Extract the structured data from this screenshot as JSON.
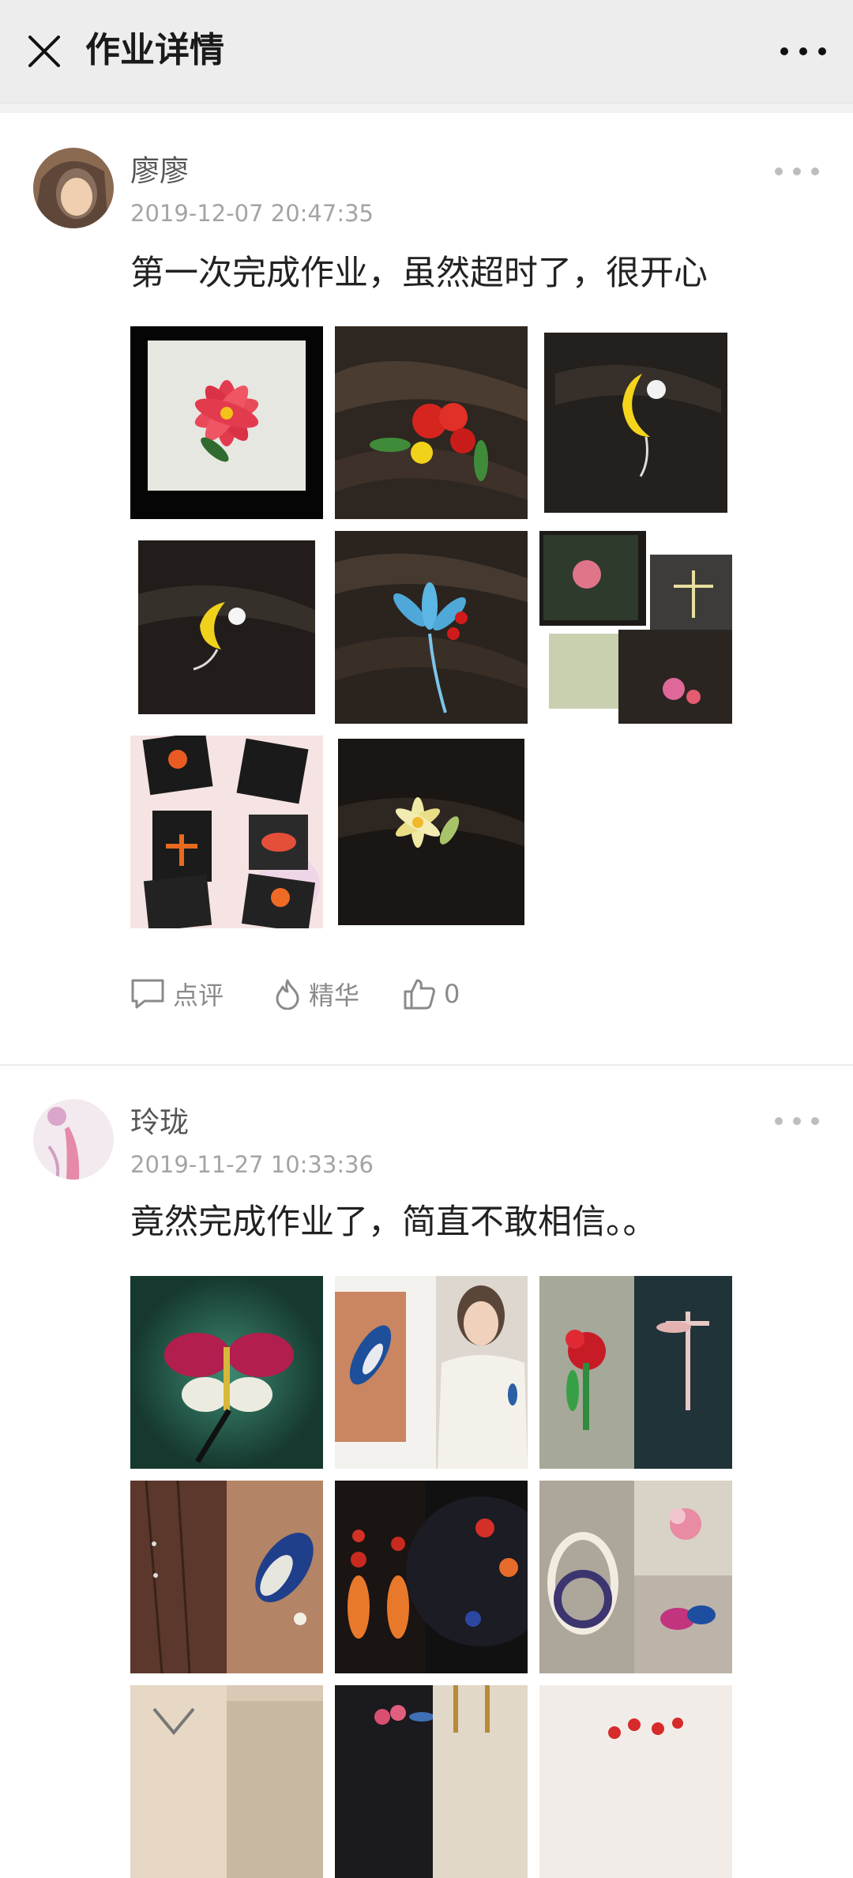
{
  "header": {
    "title": "作业详情",
    "close_icon": "close-icon",
    "more_icon": "more-horizontal-icon"
  },
  "posts": [
    {
      "author": "廖廖",
      "time": "2019-12-07 20:47:35",
      "content": "第一次完成作业，虽然超时了，很开心",
      "image_count": 8,
      "actions": {
        "comment_label": "点评",
        "highlight_label": "精华",
        "like_count": "0"
      }
    },
    {
      "author": "玲珑",
      "time": "2019-11-27 10:33:36",
      "content": "竟然完成作业了，简直不敢相信。。",
      "image_count": 9
    }
  ],
  "colors": {
    "header_bg": "#ededed",
    "meta_gray": "#a4a4a4",
    "action_gray": "#8a8a8a"
  }
}
